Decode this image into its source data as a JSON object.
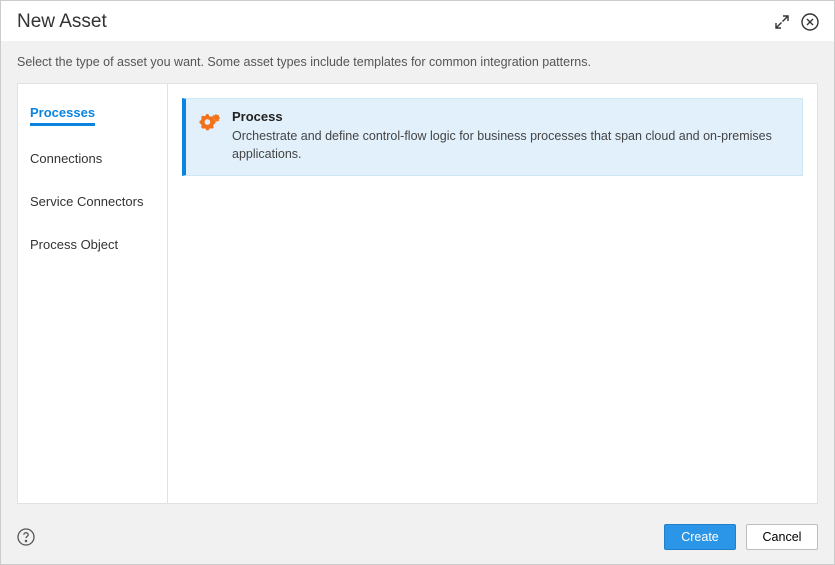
{
  "header": {
    "title": "New Asset"
  },
  "body": {
    "subtitle": "Select the type of asset you want. Some asset types include templates for common integration patterns."
  },
  "sidebar": {
    "items": [
      {
        "label": "Processes",
        "active": true
      },
      {
        "label": "Connections",
        "active": false
      },
      {
        "label": "Service Connectors",
        "active": false
      },
      {
        "label": "Process Object",
        "active": false
      }
    ]
  },
  "main": {
    "card": {
      "title": "Process",
      "description": "Orchestrate and define control-flow logic for business processes that span cloud and on-premises applications."
    }
  },
  "footer": {
    "create_label": "Create",
    "cancel_label": "Cancel"
  }
}
